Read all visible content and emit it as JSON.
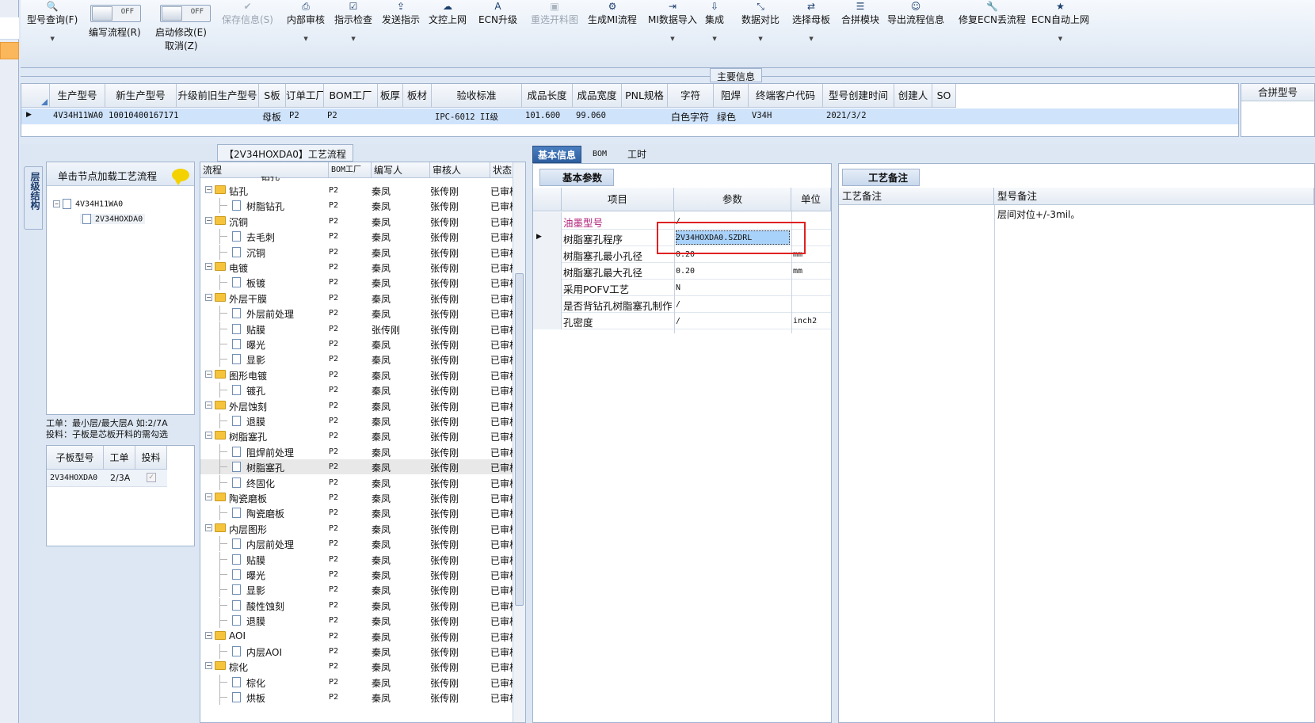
{
  "toolbar": {
    "buttons": [
      {
        "label": "型号查询(F)",
        "icon": "search-icon",
        "enabled": true,
        "dropdown": true
      },
      {
        "label": "保存信息(S)",
        "icon": "check-icon",
        "enabled": false,
        "dropdown": false
      },
      {
        "label": "内部审核",
        "icon": "printer-icon",
        "enabled": true,
        "dropdown": true
      },
      {
        "label": "指示检查",
        "icon": "checkbox-icon",
        "enabled": true,
        "dropdown": true
      },
      {
        "label": "发送指示",
        "icon": "upload-icon",
        "enabled": true,
        "dropdown": false
      },
      {
        "label": "文控上网",
        "icon": "cloud-upload-icon",
        "enabled": true,
        "dropdown": false
      },
      {
        "label": "ECN升级",
        "icon": "font-icon",
        "enabled": true,
        "dropdown": false
      },
      {
        "label": "重选开料图",
        "icon": "picture-icon",
        "enabled": false,
        "dropdown": false
      },
      {
        "label": "生成MI流程",
        "icon": "gears-icon",
        "enabled": true,
        "dropdown": false
      },
      {
        "label": "MI数据导入",
        "icon": "import-icon",
        "enabled": true,
        "dropdown": true
      },
      {
        "label": "集成",
        "icon": "download-icon",
        "enabled": true,
        "dropdown": true
      },
      {
        "label": "数据对比",
        "icon": "compress-icon",
        "enabled": true,
        "dropdown": true
      },
      {
        "label": "选择母板",
        "icon": "shuffle-icon",
        "enabled": true,
        "dropdown": true
      },
      {
        "label": "合拼模块",
        "icon": "list-icon",
        "enabled": true,
        "dropdown": false
      },
      {
        "label": "导出流程信息",
        "icon": "smile-icon",
        "enabled": true,
        "dropdown": false
      },
      {
        "label": "修复ECN丢流程",
        "icon": "wrench-icon",
        "enabled": true,
        "dropdown": false
      },
      {
        "label": "ECN自动上网",
        "icon": "star-icon",
        "enabled": true,
        "dropdown": true
      }
    ],
    "toggle_write": {
      "state": "OFF",
      "label": "编写流程(R)"
    },
    "toggle_modify": {
      "state": "OFF",
      "label": "启动修改(E)",
      "sublabel": "取消(Z)"
    }
  },
  "main_info": {
    "title": "主要信息",
    "columns": [
      "生产型号",
      "新生产型号",
      "升级前旧生产型号",
      "S板",
      "订单工厂",
      "BOM工厂",
      "板厚",
      "板材",
      "验收标准",
      "成品长度",
      "成品宽度",
      "PNL规格",
      "字符",
      "阻焊",
      "终端客户代码",
      "型号创建时间",
      "创建人",
      "SO"
    ],
    "row": {
      "生产型号": "4V34H11WA0",
      "新生产型号": "10010400167171",
      "S板": "母板",
      "订单工厂": "P2",
      "BOM工厂": "P2",
      "验收标准": "IPC-6012 II级",
      "成品长度": "101.600",
      "成品宽度": "99.060",
      "字符": "白色字符",
      "阻焊": "绿色",
      "终端客户代码": "V34H",
      "型号创建时间": "2021/3/2"
    },
    "combine_header": "合拼型号"
  },
  "left": {
    "vertical_tab": "层级结构",
    "tree_header": "单击节点加载工艺流程",
    "tree": [
      {
        "label": "4V34H11WA0",
        "level": 0
      },
      {
        "label": "2V34HOXDA0",
        "level": 1
      }
    ],
    "note_line1": "工单：最小层/最大层A 如:2/7A",
    "note_line2": "投料：子板是芯板开料的需勾选",
    "sub_columns": [
      "子板型号",
      "工单",
      "投料"
    ],
    "sub_row": {
      "model": "2V34HOXDA0",
      "order": "2/3A",
      "feed": true
    }
  },
  "process": {
    "title": "【2V34HOXDA0】工艺流程",
    "columns": [
      "流程",
      "BOM工厂",
      "编写人",
      "审核人",
      "状态"
    ],
    "partial_top": "钻孔",
    "rows": [
      {
        "name": "钻孔",
        "folder": true,
        "bom": "P2",
        "writer": "秦凤",
        "reviewer": "张传刚",
        "status": "已审核"
      },
      {
        "name": "树脂钻孔",
        "folder": false,
        "bom": "P2",
        "writer": "秦凤",
        "reviewer": "张传刚",
        "status": "已审核"
      },
      {
        "name": "沉铜",
        "folder": true,
        "bom": "P2",
        "writer": "秦凤",
        "reviewer": "张传刚",
        "status": "已审核"
      },
      {
        "name": "去毛刺",
        "folder": false,
        "bom": "P2",
        "writer": "秦凤",
        "reviewer": "张传刚",
        "status": "已审核"
      },
      {
        "name": "沉铜",
        "folder": false,
        "bom": "P2",
        "writer": "秦凤",
        "reviewer": "张传刚",
        "status": "已审核"
      },
      {
        "name": "电镀",
        "folder": true,
        "bom": "P2",
        "writer": "秦凤",
        "reviewer": "张传刚",
        "status": "已审核"
      },
      {
        "name": "板镀",
        "folder": false,
        "bom": "P2",
        "writer": "秦凤",
        "reviewer": "张传刚",
        "status": "已审核"
      },
      {
        "name": "外层干膜",
        "folder": true,
        "bom": "P2",
        "writer": "秦凤",
        "reviewer": "张传刚",
        "status": "已审核"
      },
      {
        "name": "外层前处理",
        "folder": false,
        "bom": "P2",
        "writer": "秦凤",
        "reviewer": "张传刚",
        "status": "已审核"
      },
      {
        "name": "贴膜",
        "folder": false,
        "bom": "P2",
        "writer": "张传刚",
        "reviewer": "张传刚",
        "status": "已审核"
      },
      {
        "name": "曝光",
        "folder": false,
        "bom": "P2",
        "writer": "秦凤",
        "reviewer": "张传刚",
        "status": "已审核"
      },
      {
        "name": "显影",
        "folder": false,
        "bom": "P2",
        "writer": "秦凤",
        "reviewer": "张传刚",
        "status": "已审核"
      },
      {
        "name": "图形电镀",
        "folder": true,
        "bom": "P2",
        "writer": "秦凤",
        "reviewer": "张传刚",
        "status": "已审核"
      },
      {
        "name": "镀孔",
        "folder": false,
        "bom": "P2",
        "writer": "秦凤",
        "reviewer": "张传刚",
        "status": "已审核"
      },
      {
        "name": "外层蚀刻",
        "folder": true,
        "bom": "P2",
        "writer": "秦凤",
        "reviewer": "张传刚",
        "status": "已审核"
      },
      {
        "name": "退膜",
        "folder": false,
        "bom": "P2",
        "writer": "秦凤",
        "reviewer": "张传刚",
        "status": "已审核"
      },
      {
        "name": "树脂塞孔",
        "folder": true,
        "bom": "P2",
        "writer": "秦凤",
        "reviewer": "张传刚",
        "status": "已审核"
      },
      {
        "name": "阻焊前处理",
        "folder": false,
        "bom": "P2",
        "writer": "秦凤",
        "reviewer": "张传刚",
        "status": "已审核"
      },
      {
        "name": "树脂塞孔",
        "folder": false,
        "bom": "P2",
        "writer": "秦凤",
        "reviewer": "张传刚",
        "status": "已审核",
        "selected": true
      },
      {
        "name": "终固化",
        "folder": false,
        "bom": "P2",
        "writer": "秦凤",
        "reviewer": "张传刚",
        "status": "已审核"
      },
      {
        "name": "陶瓷磨板",
        "folder": true,
        "bom": "P2",
        "writer": "秦凤",
        "reviewer": "张传刚",
        "status": "已审核"
      },
      {
        "name": "陶瓷磨板",
        "folder": false,
        "bom": "P2",
        "writer": "秦凤",
        "reviewer": "张传刚",
        "status": "已审核"
      },
      {
        "name": "内层图形",
        "folder": true,
        "bom": "P2",
        "writer": "秦凤",
        "reviewer": "张传刚",
        "status": "已审核"
      },
      {
        "name": "内层前处理",
        "folder": false,
        "bom": "P2",
        "writer": "秦凤",
        "reviewer": "张传刚",
        "status": "已审核"
      },
      {
        "name": "贴膜",
        "folder": false,
        "bom": "P2",
        "writer": "秦凤",
        "reviewer": "张传刚",
        "status": "已审核"
      },
      {
        "name": "曝光",
        "folder": false,
        "bom": "P2",
        "writer": "秦凤",
        "reviewer": "张传刚",
        "status": "已审核"
      },
      {
        "name": "显影",
        "folder": false,
        "bom": "P2",
        "writer": "秦凤",
        "reviewer": "张传刚",
        "status": "已审核"
      },
      {
        "name": "酸性蚀刻",
        "folder": false,
        "bom": "P2",
        "writer": "秦凤",
        "reviewer": "张传刚",
        "status": "已审核"
      },
      {
        "name": "退膜",
        "folder": false,
        "bom": "P2",
        "writer": "秦凤",
        "reviewer": "张传刚",
        "status": "已审核"
      },
      {
        "name": "AOI",
        "folder": true,
        "bom": "P2",
        "writer": "秦凤",
        "reviewer": "张传刚",
        "status": "已审核"
      },
      {
        "name": "内层AOI",
        "folder": false,
        "bom": "P2",
        "writer": "秦凤",
        "reviewer": "张传刚",
        "status": "已审核"
      },
      {
        "name": "棕化",
        "folder": true,
        "bom": "P2",
        "writer": "秦凤",
        "reviewer": "张传刚",
        "status": "已审核"
      },
      {
        "name": "棕化",
        "folder": false,
        "bom": "P2",
        "writer": "秦凤",
        "reviewer": "张传刚",
        "status": "已审核"
      },
      {
        "name": "烘板",
        "folder": false,
        "bom": "P2",
        "writer": "秦凤",
        "reviewer": "张传刚",
        "status": "已审核"
      }
    ]
  },
  "basic": {
    "tabs": [
      "基本信息",
      "BOM",
      "工时"
    ],
    "panel_title": "基本参数",
    "columns": [
      "项目",
      "参数",
      "单位"
    ],
    "rows": [
      {
        "item": "油墨型号",
        "param": "/",
        "unit": "",
        "highlight": true
      },
      {
        "item": "树脂塞孔程序",
        "param": "2V34HOXDA0.SZDRL",
        "unit": "",
        "selected": true
      },
      {
        "item": "树脂塞孔最小孔径",
        "param": "0.20",
        "unit": "mm"
      },
      {
        "item": "树脂塞孔最大孔径",
        "param": "0.20",
        "unit": "mm"
      },
      {
        "item": "采用POFV工艺",
        "param": "N",
        "unit": ""
      },
      {
        "item": "是否背钻孔树脂塞孔制作",
        "param": "/",
        "unit": ""
      },
      {
        "item": "孔密度",
        "param": "/",
        "unit": "inch2"
      }
    ],
    "accent_color": "#b0207a",
    "selection_color": "#a9d2fb"
  },
  "notes": {
    "panel_title": "工艺备注",
    "columns": [
      "工艺备注",
      "型号备注"
    ],
    "model_note": "层间对位+/-3mil。"
  }
}
